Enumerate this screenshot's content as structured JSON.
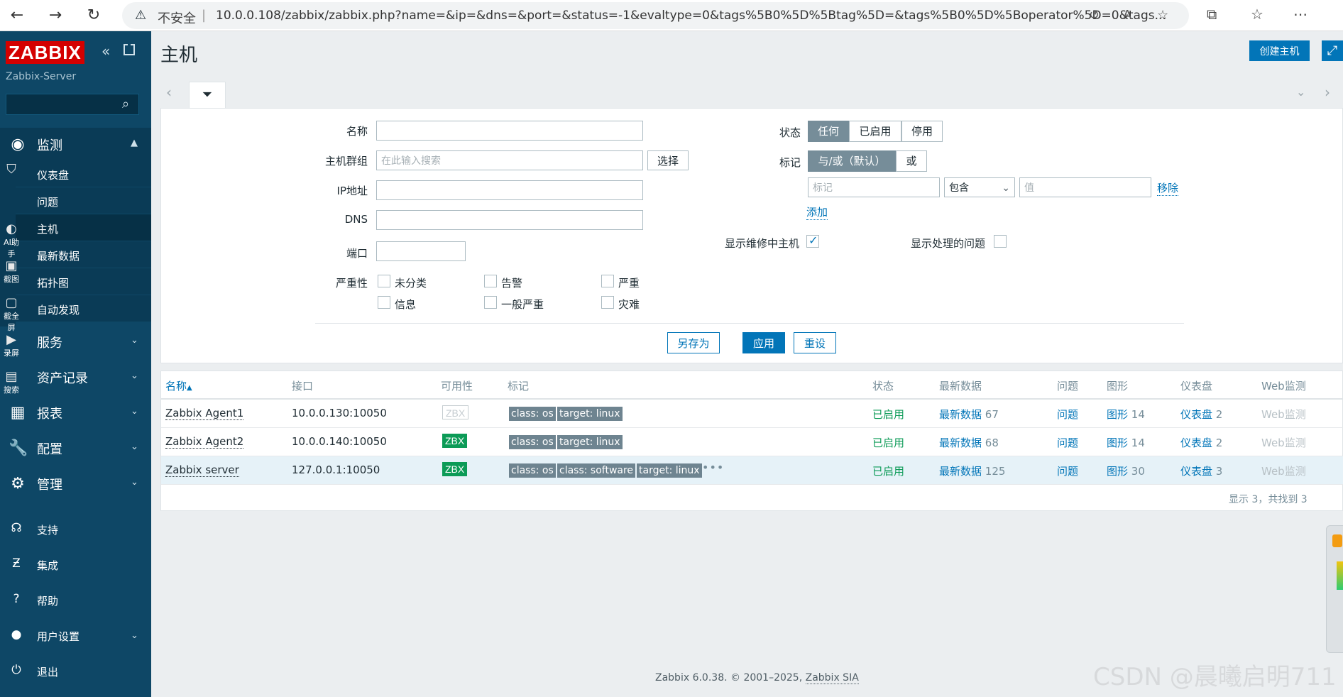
{
  "browser": {
    "security_label": "不安全",
    "separator": "|",
    "url": "10.0.0.108/zabbix/zabbix.php?name=&ip=&dns=&port=&status=-1&evaltype=0&tags%5B0%5D%5Btag%5D=&tags%5B0%5D%5Boperator%5D=0&tags..."
  },
  "sidebar": {
    "logo": "ZABBIX",
    "server_name": "Zabbix-Server",
    "search_placeholder": "",
    "menu": {
      "monitoring": "监测",
      "monitoring_items": [
        "仪表盘",
        "问题",
        "主机",
        "最新数据",
        "拓扑图",
        "自动发现"
      ],
      "services": "服务",
      "inventory": "资产记录",
      "reports": "报表",
      "configuration": "配置",
      "administration": "管理"
    },
    "bottom": {
      "support": "支持",
      "integrations": "集成",
      "help": "帮助",
      "user_settings": "用户设置",
      "logout": "退出"
    },
    "overlay_tools": [
      "AI助手",
      "截图",
      "截全屏",
      "录屏",
      "搜索"
    ]
  },
  "header": {
    "title": "主机",
    "create_host": "创建主机"
  },
  "filter": {
    "name_label": "名称",
    "host_groups_label": "主机群组",
    "host_groups_placeholder": "在此输入搜索",
    "select_button": "选择",
    "ip_label": "IP地址",
    "dns_label": "DNS",
    "port_label": "端口",
    "severity_label": "严重性",
    "severities": [
      "未分类",
      "告警",
      "严重",
      "信息",
      "一般严重",
      "灾难"
    ],
    "status_label": "状态",
    "status_options": [
      "任何",
      "已启用",
      "停用"
    ],
    "tags_label": "标记",
    "tags_mode_options": [
      "与/或（默认）",
      "或"
    ],
    "tag_placeholder": "标记",
    "operator_value": "包含",
    "value_placeholder": "值",
    "remove_link": "移除",
    "add_link": "添加",
    "show_maintenance_label": "显示维修中主机",
    "show_maintenance_checked": true,
    "show_suppressed_label": "显示处理的问题",
    "save_as": "另存为",
    "apply": "应用",
    "reset": "重设"
  },
  "table": {
    "headers": {
      "name": "名称",
      "sort_indicator": "▲",
      "interface": "接口",
      "availability": "可用性",
      "tags": "标记",
      "status": "状态",
      "latest_data": "最新数据",
      "problems": "问题",
      "graphs": "图形",
      "dashboards": "仪表盘",
      "web": "Web监测"
    },
    "rows": [
      {
        "name": "Zabbix Agent1",
        "interface": "10.0.0.130:10050",
        "availability": "ZBX",
        "tags": [
          "class: os",
          "target: linux"
        ],
        "status": "已启用",
        "latest_data": "最新数据",
        "latest_data_count": "67",
        "problems": "问题",
        "graphs": "图形",
        "graphs_count": "14",
        "dashboards": "仪表盘",
        "dashboards_count": "2",
        "web": "Web监测"
      },
      {
        "name": "Zabbix Agent2",
        "interface": "10.0.0.140:10050",
        "availability": "ZBX",
        "tags": [
          "class: os",
          "target: linux"
        ],
        "status": "已启用",
        "latest_data": "最新数据",
        "latest_data_count": "68",
        "problems": "问题",
        "graphs": "图形",
        "graphs_count": "14",
        "dashboards": "仪表盘",
        "dashboards_count": "2",
        "web": "Web监测"
      },
      {
        "name": "Zabbix server",
        "interface": "127.0.0.1:10050",
        "availability": "ZBX",
        "tags": [
          "class: os",
          "class: software",
          "target: linux"
        ],
        "more": "•••",
        "status": "已启用",
        "latest_data": "最新数据",
        "latest_data_count": "125",
        "problems": "问题",
        "graphs": "图形",
        "graphs_count": "30",
        "dashboards": "仪表盘",
        "dashboards_count": "3",
        "web": "Web监测"
      }
    ],
    "footer": "显示 3，共找到 3"
  },
  "footer": {
    "version": "Zabbix 6.0.38. © 2001–2025,",
    "company": "Zabbix SIA"
  },
  "watermark": "CSDN @晨曦启明711",
  "colors": {
    "sidebar_bg": "#0e4766",
    "accent": "#0275b8",
    "logo_red": "#d40000",
    "status_green": "#0c9b57"
  }
}
